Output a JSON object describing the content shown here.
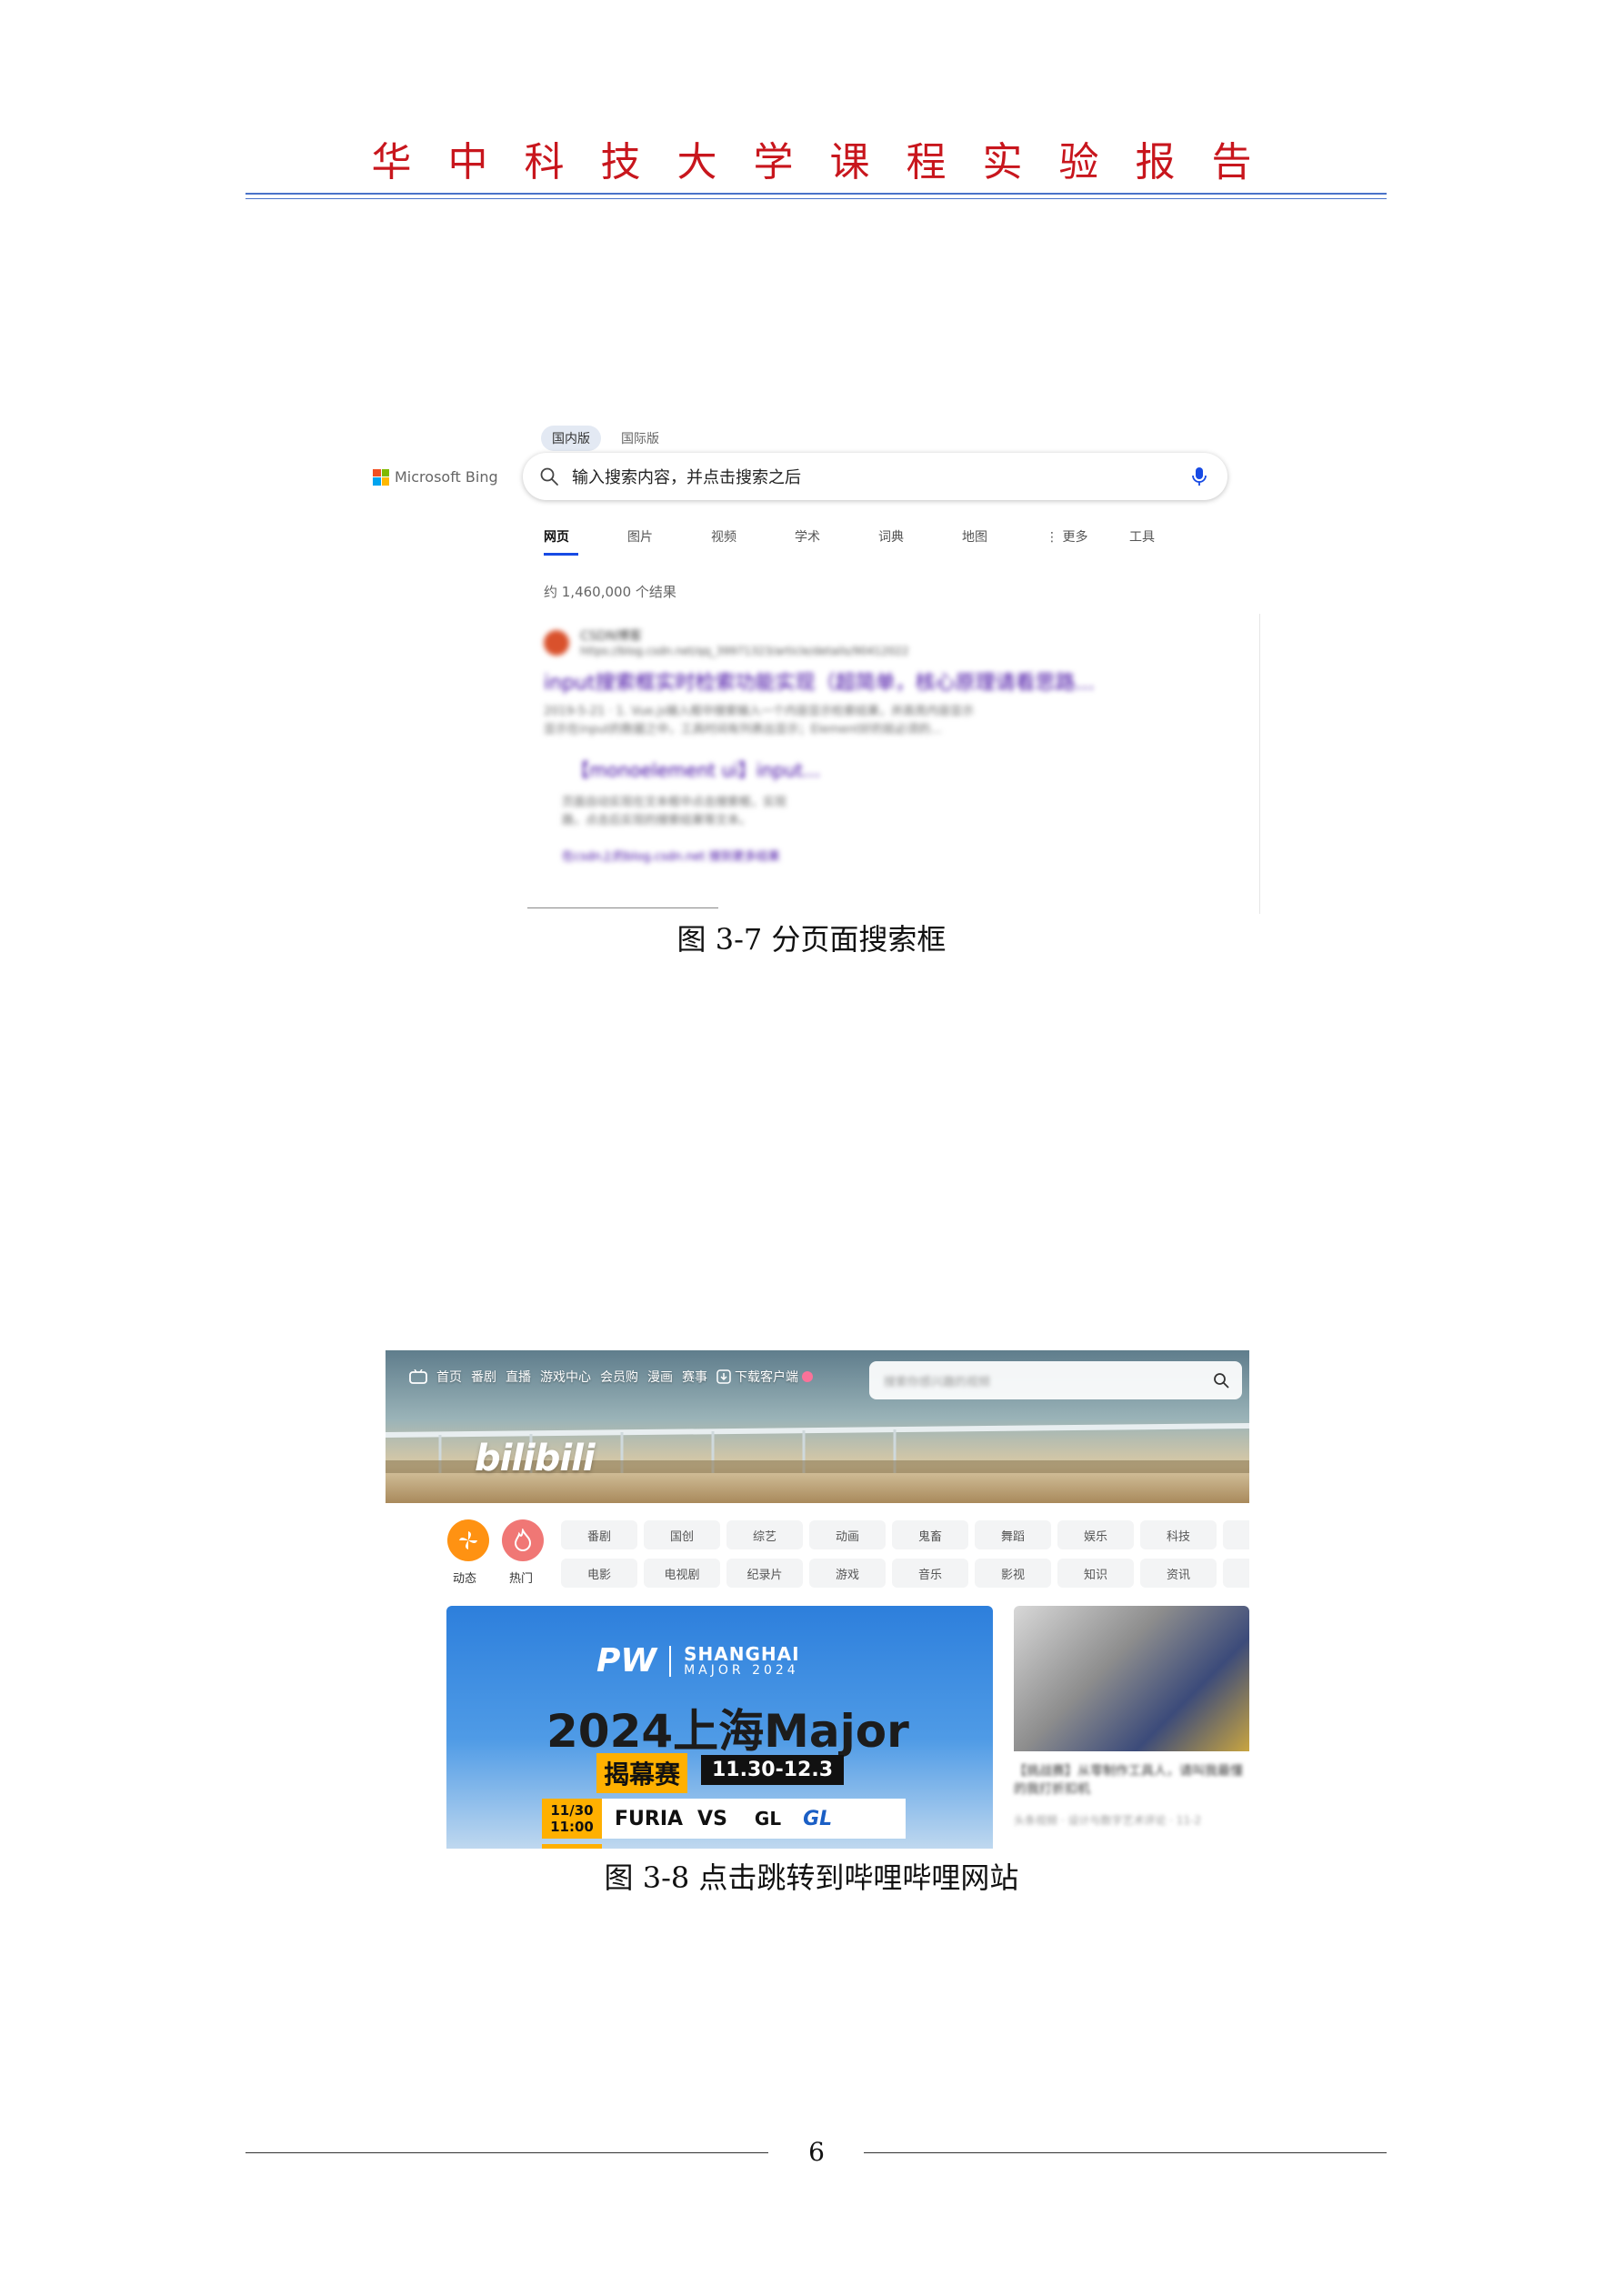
{
  "header": {
    "title": "华中科技大学课程实验报告"
  },
  "figure1": {
    "caption": "图 3-7    分页面搜索框",
    "bing": {
      "region_tabs": [
        "国内版",
        "国际版"
      ],
      "logo_text": "Microsoft Bing",
      "search_value": "输入搜索内容，并点击搜索之后",
      "nav_tabs": [
        "网页",
        "图片",
        "视频",
        "学术",
        "词典",
        "地图",
        "⋮ 更多",
        "工具"
      ],
      "result_count": "约 1,460,000 个结果",
      "result": {
        "site_name": "CSDN博客",
        "url": "https://blog.csdn.net/qq_39971323/article/details/90412022",
        "title": "input搜索框实时检索功能实现（超简单，核心原理请看思路...",
        "snippet_1": "2019-5-21 · 1. Vue.js输入框中搜索输入一个内容显示检索结果，并高亮内容显示",
        "snippet_2": "显示在input的数据之中，工具时间有列表出显示；Element好的就必须的...",
        "sub_title": "【monoelement ui】input...",
        "sub_snippet_1": "页面自动实现在文本框中点击搜索框，实现",
        "sub_snippet_2": "路，点击后实现的搜索结果等文本。",
        "link": "在csdn上的blog.csdn.net 搜到更多结果"
      }
    },
    "colors": {
      "ms_squares": [
        "#f25022",
        "#7fba00",
        "#00a4ef",
        "#ffb900"
      ],
      "bing_accent": "#174ae4"
    }
  },
  "figure2": {
    "caption": "图 3-8    点击跳转到哔哩哔哩网站",
    "bilibili": {
      "topnav": [
        "首页",
        "番剧",
        "直播",
        "游戏中心",
        "会员购",
        "漫画",
        "赛事",
        "下载客户端"
      ],
      "search_placeholder": "搜索你感兴趣的视频",
      "logo_text": "bilibili",
      "dynamic_label": "动态",
      "hot_label": "热门",
      "channels_row1": [
        "番剧",
        "国创",
        "综艺",
        "动画",
        "鬼畜",
        "舞蹈",
        "娱乐",
        "科技"
      ],
      "channels_row2": [
        "电影",
        "电视剧",
        "纪录片",
        "游戏",
        "音乐",
        "影视",
        "知识",
        "资讯"
      ],
      "promo": {
        "brand": "PW",
        "event": "SHANGHAI",
        "major_line": "MAJOR 2024",
        "title": "2024上海Major",
        "badge": "揭幕赛",
        "date": "11.30-12.3",
        "match_time_1": "11/30",
        "match_time_2": "11:00",
        "team1": "FURIA",
        "vs": "VS",
        "team2": "GL",
        "team2_logo": "GL"
      },
      "video": {
        "title": "【挑战赛】从零制作工具人，请叫我最懂的我打折扣机",
        "meta": "头条视频 · 设计与数字艺术评论 · 11-2"
      }
    },
    "colors": {
      "accent_pink": "#fb7299",
      "dynamic_orange": "#ff9212",
      "hot_red": "#f07775"
    }
  },
  "footer": {
    "page_number": "6"
  }
}
